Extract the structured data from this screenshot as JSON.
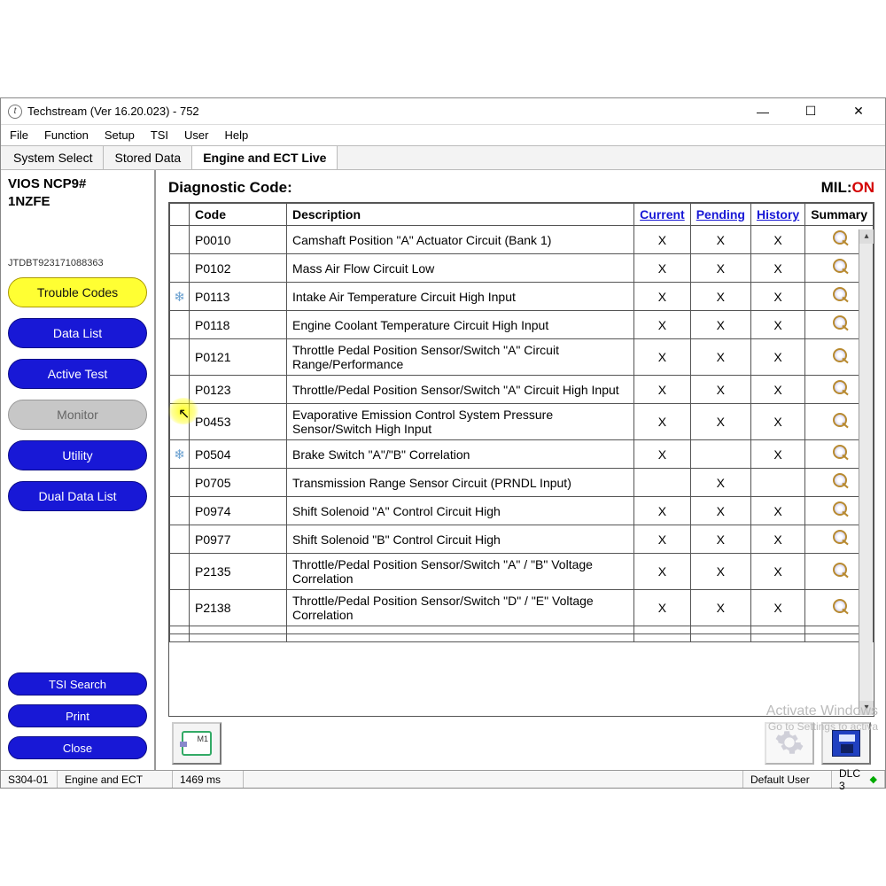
{
  "window": {
    "title": "Techstream (Ver 16.20.023) - 752"
  },
  "menubar": [
    "File",
    "Function",
    "Setup",
    "TSI",
    "User",
    "Help"
  ],
  "tabs": [
    {
      "label": "System Select",
      "active": false
    },
    {
      "label": "Stored Data",
      "active": false
    },
    {
      "label": "Engine and ECT Live",
      "active": true
    }
  ],
  "sidebar": {
    "model": "VIOS NCP9#",
    "engine": "1NZFE",
    "vin": "JTDBT923171088363",
    "nav": [
      {
        "key": "trouble-codes",
        "label": "Trouble Codes",
        "style": "yellow"
      },
      {
        "key": "data-list",
        "label": "Data List",
        "style": "blue"
      },
      {
        "key": "active-test",
        "label": "Active Test",
        "style": "blue"
      },
      {
        "key": "monitor",
        "label": "Monitor",
        "style": "gray"
      },
      {
        "key": "utility",
        "label": "Utility",
        "style": "blue"
      },
      {
        "key": "dual-data-list",
        "label": "Dual Data List",
        "style": "blue"
      }
    ],
    "actions": [
      {
        "key": "tsi-search",
        "label": "TSI Search"
      },
      {
        "key": "print",
        "label": "Print"
      },
      {
        "key": "close",
        "label": "Close"
      }
    ]
  },
  "main": {
    "heading": "Diagnostic Code:",
    "mil_label": "MIL:",
    "mil_status": "ON",
    "columns": {
      "code": "Code",
      "desc": "Description",
      "current": "Current",
      "pending": "Pending",
      "history": "History",
      "summary": "Summary"
    },
    "rows": [
      {
        "icon": "",
        "code": "P0010",
        "desc": "Camshaft Position \"A\" Actuator Circuit (Bank 1)",
        "cur": "X",
        "pen": "X",
        "his": "X",
        "sum": true
      },
      {
        "icon": "",
        "code": "P0102",
        "desc": "Mass Air Flow Circuit Low",
        "cur": "X",
        "pen": "X",
        "his": "X",
        "sum": true
      },
      {
        "icon": "snow",
        "code": "P0113",
        "desc": "Intake Air Temperature Circuit High Input",
        "cur": "X",
        "pen": "X",
        "his": "X",
        "sum": true
      },
      {
        "icon": "",
        "code": "P0118",
        "desc": "Engine Coolant Temperature Circuit High Input",
        "cur": "X",
        "pen": "X",
        "his": "X",
        "sum": true
      },
      {
        "icon": "",
        "code": "P0121",
        "desc": "Throttle Pedal Position Sensor/Switch \"A\" Circuit Range/Performance",
        "cur": "X",
        "pen": "X",
        "his": "X",
        "sum": true
      },
      {
        "icon": "",
        "code": "P0123",
        "desc": "Throttle/Pedal Position Sensor/Switch \"A\" Circuit High Input",
        "cur": "X",
        "pen": "X",
        "his": "X",
        "sum": true
      },
      {
        "icon": "",
        "code": "P0453",
        "desc": "Evaporative Emission Control System Pressure Sensor/Switch High Input",
        "cur": "X",
        "pen": "X",
        "his": "X",
        "sum": true
      },
      {
        "icon": "snow",
        "code": "P0504",
        "desc": "Brake Switch \"A\"/\"B\" Correlation",
        "cur": "X",
        "pen": "",
        "his": "X",
        "sum": true
      },
      {
        "icon": "",
        "code": "P0705",
        "desc": "Transmission Range Sensor Circuit (PRNDL Input)",
        "cur": "",
        "pen": "X",
        "his": "",
        "sum": true
      },
      {
        "icon": "",
        "code": "P0974",
        "desc": "Shift Solenoid \"A\" Control Circuit High",
        "cur": "X",
        "pen": "X",
        "his": "X",
        "sum": true
      },
      {
        "icon": "",
        "code": "P0977",
        "desc": "Shift Solenoid \"B\" Control Circuit High",
        "cur": "X",
        "pen": "X",
        "his": "X",
        "sum": true
      },
      {
        "icon": "",
        "code": "P2135",
        "desc": "Throttle/Pedal Position Sensor/Switch \"A\" / \"B\" Voltage Correlation",
        "cur": "X",
        "pen": "X",
        "his": "X",
        "sum": true
      },
      {
        "icon": "",
        "code": "P2138",
        "desc": "Throttle/Pedal Position Sensor/Switch \"D\" / \"E\" Voltage Correlation",
        "cur": "X",
        "pen": "X",
        "his": "X",
        "sum": true
      },
      {
        "icon": "",
        "code": "",
        "desc": "",
        "cur": "",
        "pen": "",
        "his": "",
        "sum": false
      },
      {
        "icon": "",
        "code": "",
        "desc": "",
        "cur": "",
        "pen": "",
        "his": "",
        "sum": false
      }
    ]
  },
  "statusbar": {
    "left1": "S304-01",
    "left2": "Engine and ECT",
    "ms": "1469 ms",
    "user": "Default User",
    "dlc": "DLC 3"
  },
  "watermark": {
    "line1": "Activate Windows",
    "line2": "Go to Settings to activa"
  }
}
